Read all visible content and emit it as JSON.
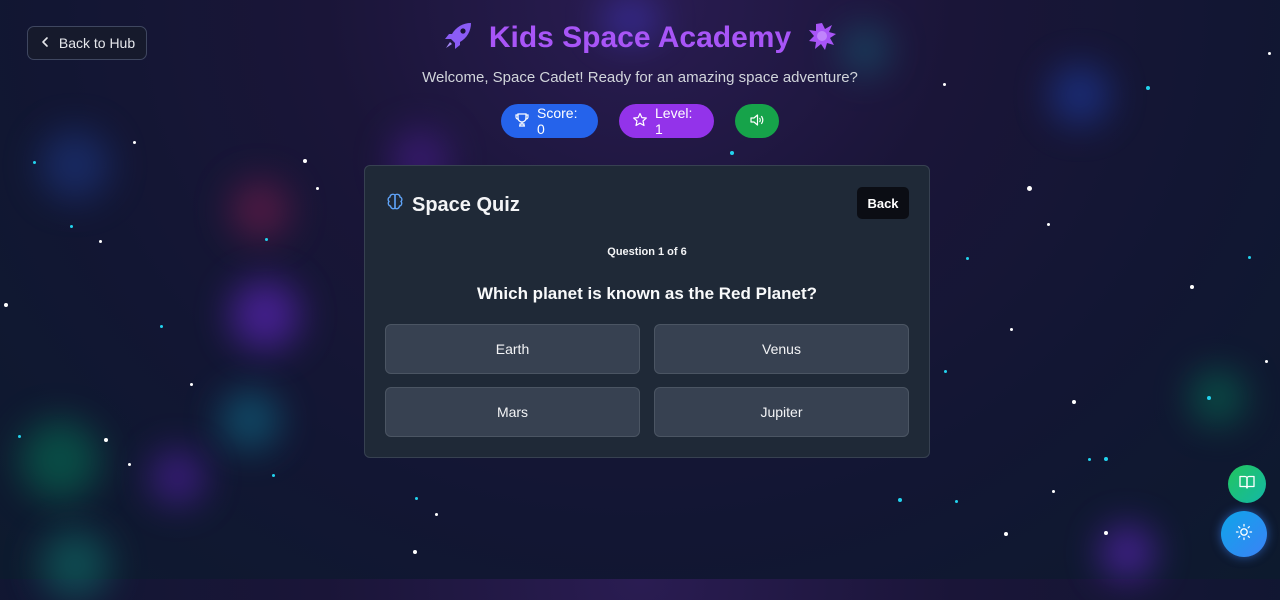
{
  "nav": {
    "back_to_hub_label": "Back to Hub"
  },
  "header": {
    "title": "Kids Space Academy",
    "subtitle": "Welcome, Space Cadet! Ready for an amazing space adventure?",
    "left_icon": "rocket-icon",
    "right_icon": "splat-icon"
  },
  "stats": {
    "score_label": "Score: 0",
    "level_label": "Level: 1",
    "sound_icon": "speaker-icon"
  },
  "quiz": {
    "title": "Space Quiz",
    "title_icon": "brain-icon",
    "back_label": "Back",
    "progress": "Question 1 of 6",
    "question": "Which planet is known as the Red Planet?",
    "options": [
      "Earth",
      "Venus",
      "Mars",
      "Jupiter"
    ]
  },
  "floating_buttons": {
    "book_icon": "book-open-icon",
    "theme_icon": "sun-icon"
  },
  "colors": {
    "accent_purple": "#a855f7",
    "score_blue": "#2563eb",
    "level_purple": "#9333ea",
    "sound_green": "#16a34a",
    "card_bg": "#1f2937",
    "option_bg": "#374151"
  }
}
